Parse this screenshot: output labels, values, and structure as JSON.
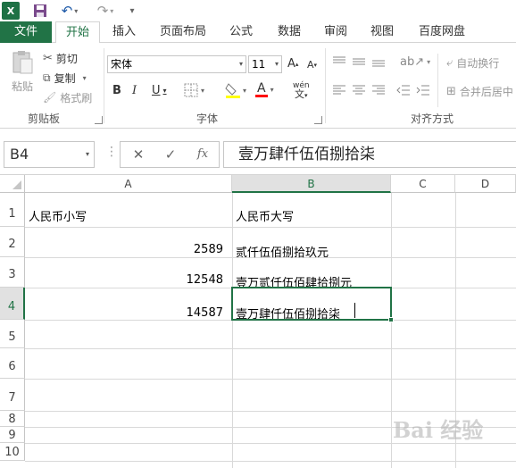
{
  "tabs": [
    "文件",
    "开始",
    "插入",
    "页面布局",
    "公式",
    "数据",
    "审阅",
    "视图",
    "百度网盘"
  ],
  "clipboard": {
    "paste": "粘贴",
    "cut": "剪切",
    "copy": "复制",
    "format_painter": "格式刷",
    "group": "剪贴板"
  },
  "font": {
    "name": "宋体",
    "size": "11",
    "group": "字体"
  },
  "alignment": {
    "wrap_text": "自动换行",
    "merge_center": "合并后居中",
    "group": "对齐方式"
  },
  "name_box": "B4",
  "formula": "壹万肆仟伍佰捌拾柒",
  "columns": [
    "A",
    "B",
    "C",
    "D"
  ],
  "rows": [
    "1",
    "2",
    "3",
    "4",
    "5",
    "6",
    "7",
    "8",
    "9",
    "10"
  ],
  "cells": {
    "A1": "人民币小写",
    "B1": "人民币大写",
    "A2": "2589",
    "B2": "贰仟伍佰捌拾玖元",
    "A3": "12548",
    "B3": "壹万贰仟伍佰肆拾捌元",
    "A4": "14587",
    "B4": "壹万肆仟伍佰捌拾柒"
  },
  "watermark": "Bai 经验",
  "colors": {
    "excel_green": "#217346",
    "accent_red": "#ff0000"
  }
}
